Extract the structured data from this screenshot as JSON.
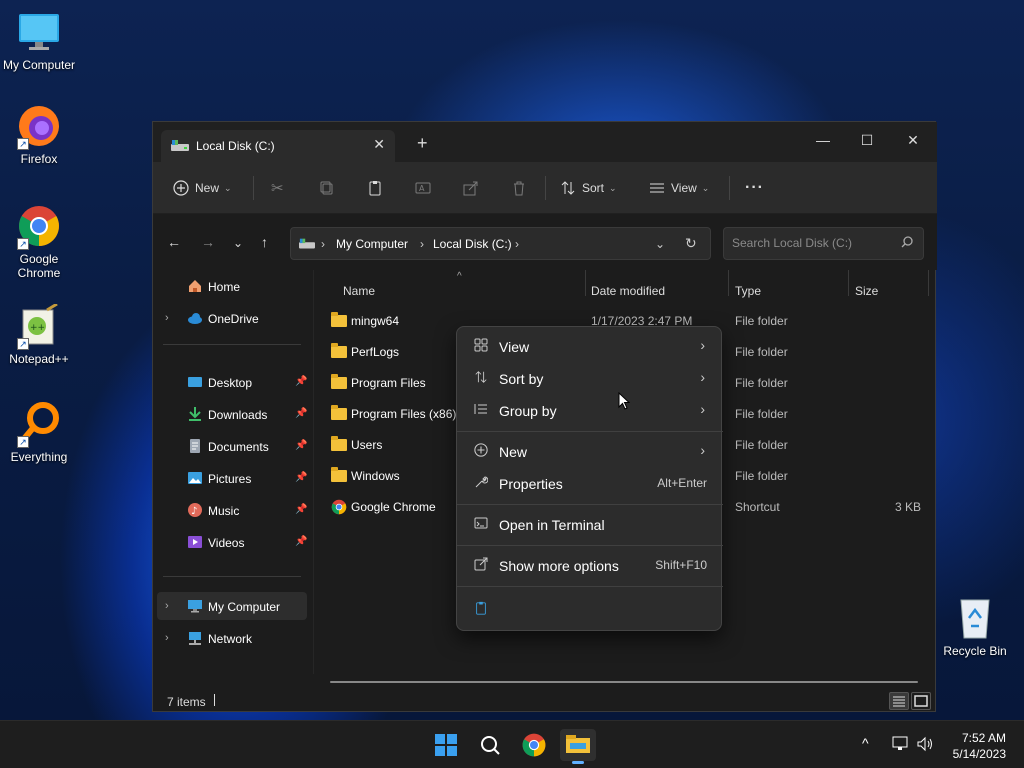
{
  "desktop": {
    "icons": [
      {
        "label": "My Computer"
      },
      {
        "label": "Firefox"
      },
      {
        "label": "Google\nChrome",
        "line1": "Google",
        "line2": "Chrome"
      },
      {
        "label": "Notepad++"
      },
      {
        "label": "Everything"
      },
      {
        "label": "Recycle Bin"
      }
    ]
  },
  "window": {
    "tab_title": "Local Disk (C:)",
    "toolbar": {
      "new_label": "New",
      "sort_label": "Sort",
      "view_label": "View",
      "more_label": "···"
    },
    "address": {
      "segments": [
        "My Computer",
        "Local Disk (C:)"
      ]
    },
    "search": {
      "placeholder": "Search Local Disk (C:)"
    },
    "nav": {
      "home": "Home",
      "onedrive": "OneDrive",
      "quick_access": [
        "Desktop",
        "Downloads",
        "Documents",
        "Pictures",
        "Music",
        "Videos"
      ],
      "my_computer": "My Computer",
      "network": "Network"
    },
    "columns": {
      "name": "Name",
      "date": "Date modified",
      "type": "Type",
      "size": "Size"
    },
    "rows": [
      {
        "name": "mingw64",
        "date": "1/17/2023 2:47 PM",
        "type": "File folder",
        "size": ""
      },
      {
        "name": "PerfLogs",
        "date": "",
        "type": "File folder",
        "size": ""
      },
      {
        "name": "Program Files",
        "date": "",
        "type": "File folder",
        "size": ""
      },
      {
        "name": "Program Files (x86)",
        "date": "",
        "type": "File folder",
        "size": ""
      },
      {
        "name": "Users",
        "date": "",
        "type": "File folder",
        "size": ""
      },
      {
        "name": "Windows",
        "date": "",
        "type": "File folder",
        "size": ""
      },
      {
        "name": "Google Chrome",
        "date": "",
        "type": "Shortcut",
        "size": "3 KB"
      }
    ],
    "status": {
      "count": "7 items"
    }
  },
  "context_menu": {
    "items": [
      {
        "label": "View",
        "shortcut": ""
      },
      {
        "label": "Sort by",
        "shortcut": ""
      },
      {
        "label": "Group by",
        "shortcut": ""
      },
      {
        "label": "New",
        "shortcut": ""
      },
      {
        "label": "Properties",
        "shortcut": "Alt+Enter"
      },
      {
        "label": "Open in Terminal",
        "shortcut": ""
      },
      {
        "label": "Show more options",
        "shortcut": "Shift+F10"
      }
    ]
  },
  "taskbar": {
    "time": "7:52 AM",
    "date": "5/14/2023"
  },
  "colors": {
    "accent": "#0078d4",
    "folder": "#f3c13a",
    "window_bg": "#1c1c1c",
    "menu_bg": "#2c2c2c"
  }
}
